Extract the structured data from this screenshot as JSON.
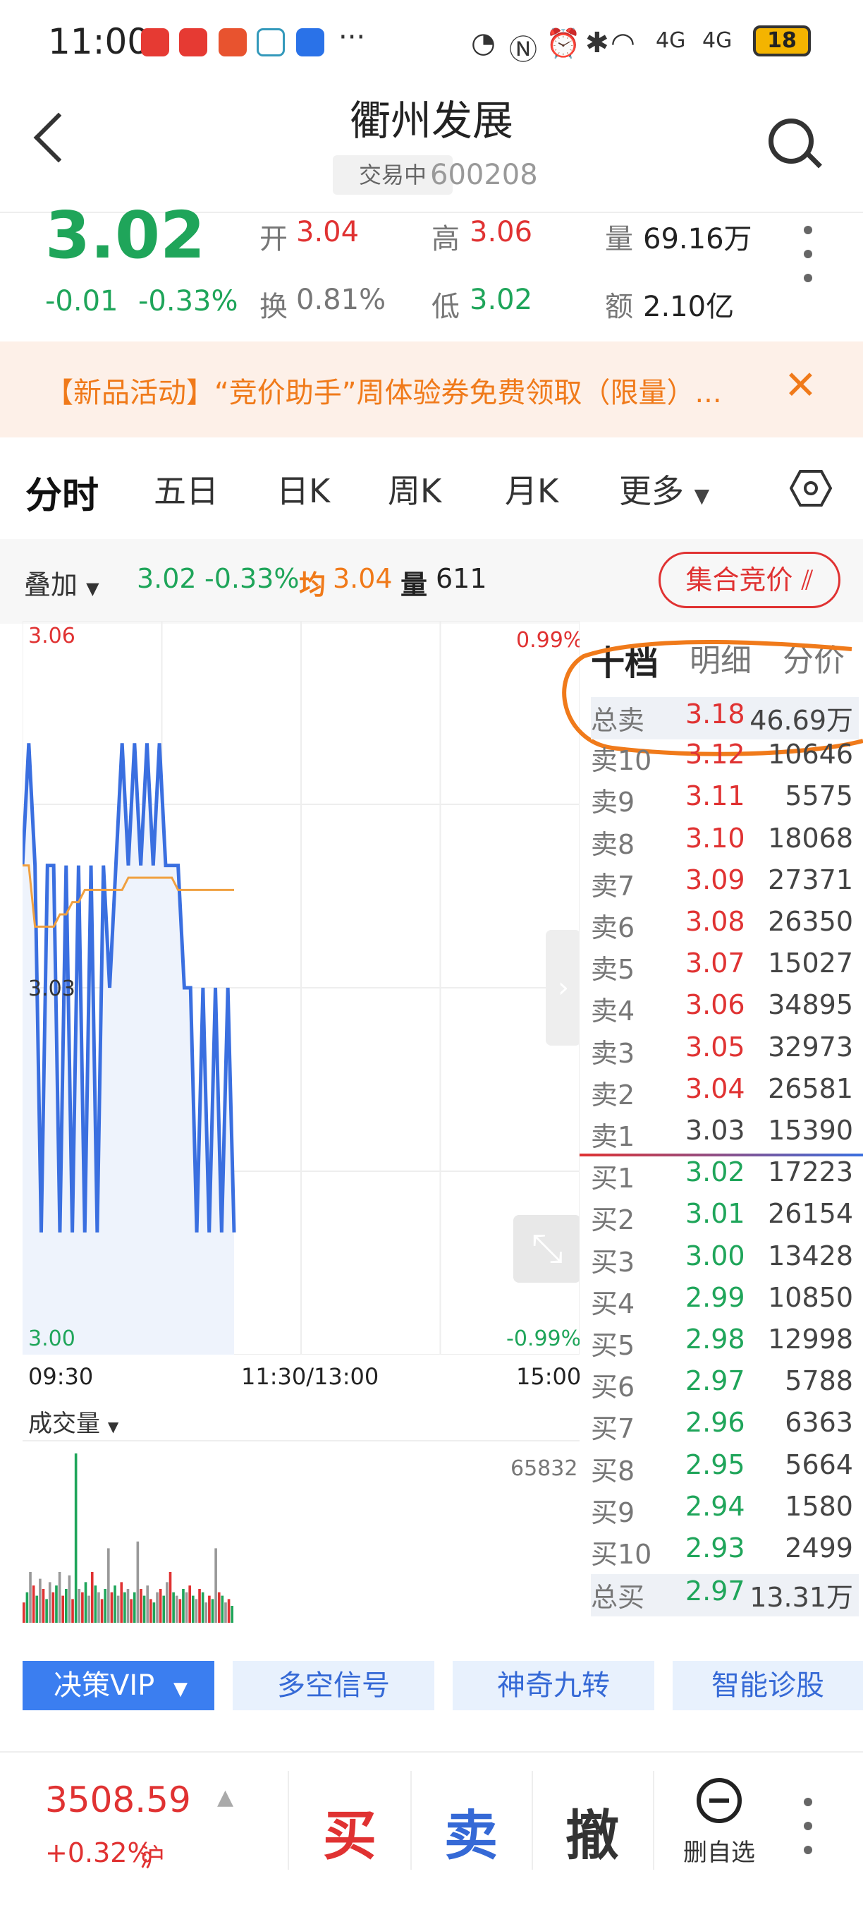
{
  "status_bar": {
    "time": "11:00",
    "more": "···",
    "signal": "4G",
    "battery": "18"
  },
  "header": {
    "title": "衢州发展",
    "trading_status": "交易中",
    "stock_code": "600208"
  },
  "quote": {
    "price": "3.02",
    "change": "-0.01",
    "change_pct": "-0.33%",
    "open_label": "开",
    "open": "3.04",
    "high_label": "高",
    "high": "3.06",
    "volume_label": "量",
    "volume": "69.16万",
    "turnover_label": "换",
    "turnover": "0.81%",
    "low_label": "低",
    "low": "3.02",
    "amount_label": "额",
    "amount": "2.10亿"
  },
  "banner": {
    "text": "【新品活动】“竞价助手”周体验券免费领取（限量）...",
    "close": "✕"
  },
  "tabs": [
    "分时",
    "五日",
    "日K",
    "周K",
    "月K",
    "更多"
  ],
  "overlay": {
    "label": "叠加",
    "price": "3.02",
    "pct": "-0.33%",
    "avg_label": "均",
    "avg": "3.04",
    "vol_label": "量",
    "vol": "611",
    "auction_label": "集合竞价"
  },
  "chart_data": {
    "type": "line",
    "y_max_label": "3.06",
    "y_mid_label": "3.03",
    "y_min_label": "3.00",
    "pct_max_label": "0.99%",
    "pct_min_label": "-0.99%",
    "x_labels": [
      "09:30",
      "11:30/13:00",
      "15:00"
    ],
    "ylim": [
      3.0,
      3.06
    ],
    "series": [
      {
        "values": [
          3.04,
          3.05,
          3.04,
          3.01,
          3.04,
          3.04,
          3.01,
          3.04,
          3.01,
          3.04,
          3.01,
          3.04,
          3.01,
          3.04,
          3.03,
          3.04,
          3.05,
          3.04,
          3.05,
          3.04,
          3.05,
          3.04,
          3.05,
          3.04,
          3.04,
          3.04,
          3.03,
          3.03,
          3.01,
          3.03,
          3.01,
          3.03,
          3.01,
          3.03,
          3.01
        ]
      },
      {
        "values": [
          3.04,
          3.04,
          3.035,
          3.035,
          3.035,
          3.035,
          3.036,
          3.036,
          3.037,
          3.037,
          3.038,
          3.038,
          3.038,
          3.038,
          3.038,
          3.038,
          3.038,
          3.039,
          3.039,
          3.039,
          3.039,
          3.039,
          3.039,
          3.039,
          3.039,
          3.038,
          3.038,
          3.038,
          3.038,
          3.038,
          3.038,
          3.038,
          3.038,
          3.038,
          3.038
        ]
      }
    ]
  },
  "volume_chart": {
    "label": "成交量",
    "max_label": "65832",
    "bars": [
      12,
      18,
      30,
      22,
      16,
      26,
      20,
      14,
      24,
      18,
      22,
      30,
      16,
      20,
      28,
      14,
      100,
      20,
      18,
      24,
      16,
      30,
      22,
      18,
      14,
      20,
      44,
      18,
      22,
      16,
      24,
      18,
      20,
      14,
      18,
      48,
      20,
      16,
      22,
      14,
      12,
      18,
      20,
      16,
      24,
      30,
      18,
      16,
      14,
      20,
      18,
      22,
      16,
      14,
      20,
      18,
      12,
      16,
      14,
      44,
      18,
      16,
      12,
      14,
      10
    ]
  },
  "order_book": {
    "tabs": [
      "十档",
      "明细",
      "分价"
    ],
    "total_sell_label": "总卖",
    "total_sell_price": "3.18",
    "total_sell_vol": "46.69万",
    "asks": [
      {
        "label": "卖10",
        "price": "3.12",
        "vol": "10646"
      },
      {
        "label": "卖9",
        "price": "3.11",
        "vol": "5575"
      },
      {
        "label": "卖8",
        "price": "3.10",
        "vol": "18068"
      },
      {
        "label": "卖7",
        "price": "3.09",
        "vol": "27371"
      },
      {
        "label": "卖6",
        "price": "3.08",
        "vol": "26350"
      },
      {
        "label": "卖5",
        "price": "3.07",
        "vol": "15027"
      },
      {
        "label": "卖4",
        "price": "3.06",
        "vol": "34895"
      },
      {
        "label": "卖3",
        "price": "3.05",
        "vol": "32973"
      },
      {
        "label": "卖2",
        "price": "3.04",
        "vol": "26581"
      },
      {
        "label": "卖1",
        "price": "3.03",
        "vol": "15390"
      }
    ],
    "bids": [
      {
        "label": "买1",
        "price": "3.02",
        "vol": "17223"
      },
      {
        "label": "买2",
        "price": "3.01",
        "vol": "26154"
      },
      {
        "label": "买3",
        "price": "3.00",
        "vol": "13428"
      },
      {
        "label": "买4",
        "price": "2.99",
        "vol": "10850"
      },
      {
        "label": "买5",
        "price": "2.98",
        "vol": "12998"
      },
      {
        "label": "买6",
        "price": "2.97",
        "vol": "5788"
      },
      {
        "label": "买7",
        "price": "2.96",
        "vol": "6363"
      },
      {
        "label": "买8",
        "price": "2.95",
        "vol": "5664"
      },
      {
        "label": "买9",
        "price": "2.94",
        "vol": "1580"
      },
      {
        "label": "买10",
        "price": "2.93",
        "vol": "2499"
      }
    ],
    "total_buy_label": "总买",
    "total_buy_price": "2.97",
    "total_buy_vol": "13.31万"
  },
  "indicators": {
    "vip": "决策VIP",
    "items": [
      "多空信号",
      "神奇九转",
      "智能诊股"
    ]
  },
  "bottom": {
    "index_value": "3508.59",
    "index_change": "+0.32%",
    "index_market": "沪",
    "buy": "买",
    "sell": "卖",
    "cancel": "撤",
    "remove_watchlist": "删自选"
  },
  "colors": {
    "up": "#e03232",
    "down": "#1fa55a",
    "line": "#3a6fe0",
    "avg": "#f0a040",
    "accent": "#f07a1a"
  }
}
